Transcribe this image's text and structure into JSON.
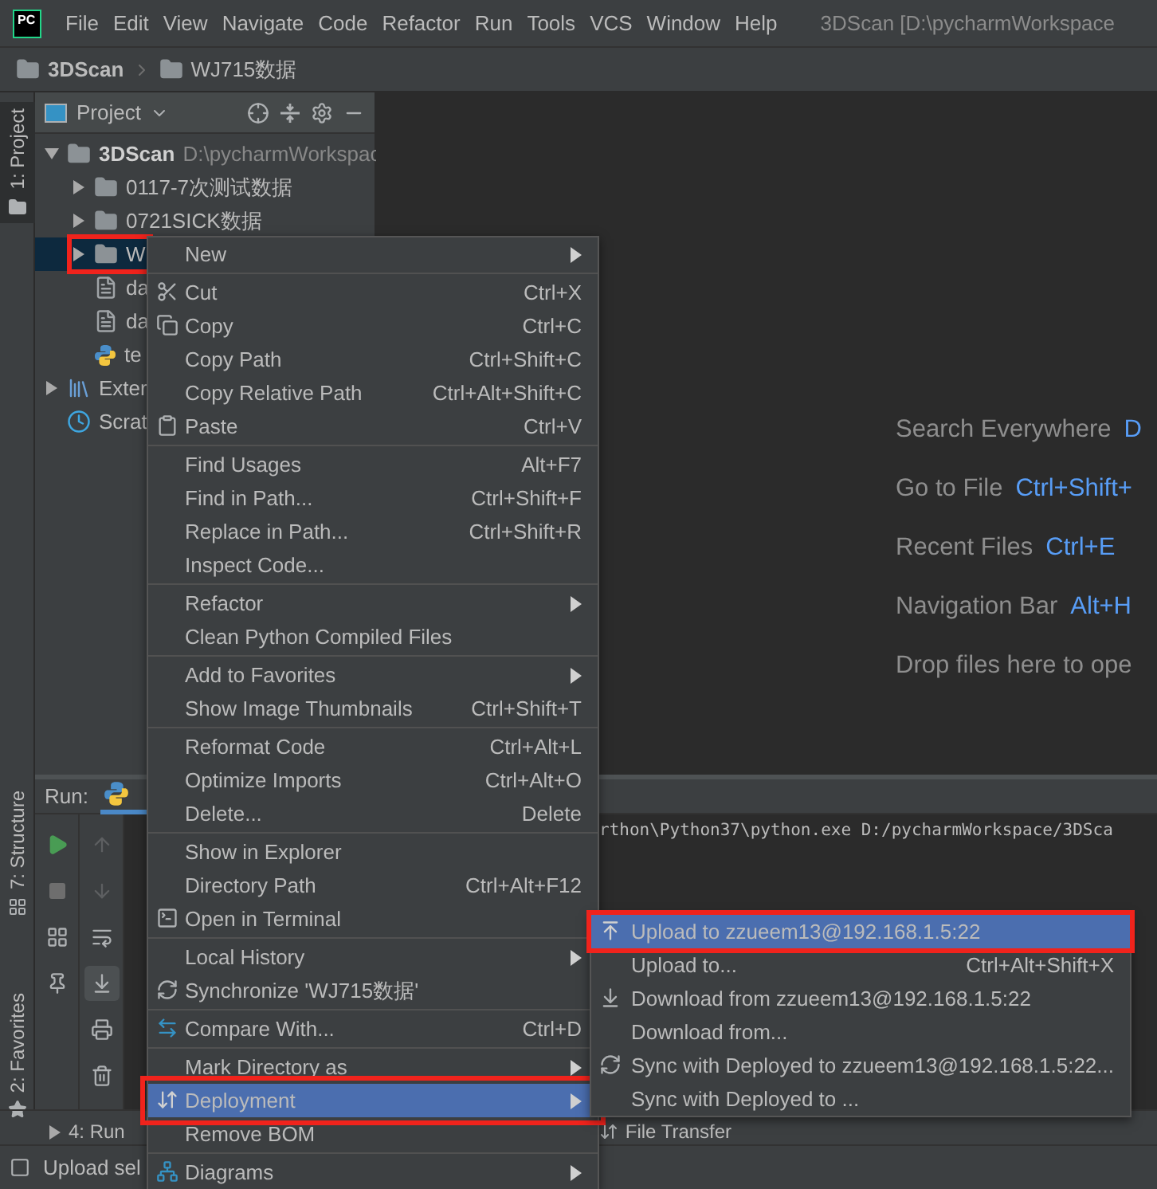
{
  "logo": "PC",
  "menubar": [
    "File",
    "Edit",
    "View",
    "Navigate",
    "Code",
    "Refactor",
    "Run",
    "Tools",
    "VCS",
    "Window",
    "Help"
  ],
  "window_title": "3DScan [D:\\pycharmWorkspace",
  "breadcrumb": [
    "3DScan",
    "WJ715数据"
  ],
  "tool_strip": [
    {
      "label": "1: Project",
      "selected": true
    },
    {
      "label": "7: Structure",
      "selected": false
    },
    {
      "label": "2: Favorites",
      "selected": false
    }
  ],
  "project_panel": {
    "title": "Project",
    "tree": [
      {
        "label": "3DScan",
        "path": "D:\\pycharmWorkspac",
        "kind": "folder",
        "expanded": true,
        "selected": false,
        "children": [
          {
            "label": "0117-7次测试数据",
            "kind": "folder",
            "expanded": false,
            "selected": false
          },
          {
            "label": "0721SICK数据",
            "kind": "folder",
            "expanded": false,
            "selected": false
          },
          {
            "label": "W",
            "kind": "folder",
            "expanded": false,
            "selected": true
          },
          {
            "label": "da",
            "kind": "file",
            "selected": false
          },
          {
            "label": "da",
            "kind": "file",
            "selected": false
          },
          {
            "label": "te",
            "kind": "python",
            "selected": false
          }
        ]
      },
      {
        "label": "Exter",
        "kind": "library",
        "expanded": false,
        "selected": false
      },
      {
        "label": "Scrat",
        "kind": "scratch",
        "selected": false
      }
    ]
  },
  "editor_hints": [
    {
      "label": "Search Everywhere",
      "shortcut": "D"
    },
    {
      "label": "Go to File",
      "shortcut": "Ctrl+Shift+"
    },
    {
      "label": "Recent Files",
      "shortcut": "Ctrl+E"
    },
    {
      "label": "Navigation Bar",
      "shortcut": "Alt+H"
    },
    {
      "label": "Drop files here to ope"
    }
  ],
  "run_panel": {
    "title": "Run:",
    "console_line": "rthon\\Python37\\python.exe D:/pycharmWorkspace/3DSca"
  },
  "bottom_tabs": [
    {
      "label": "4: Run"
    },
    {
      "label": "File Transfer"
    }
  ],
  "status_bar": "Upload sel",
  "context_menu": [
    {
      "kind": "item",
      "label": "New",
      "submenu": true,
      "selected": false
    },
    {
      "kind": "separator"
    },
    {
      "kind": "item",
      "label": "Cut",
      "shortcut": "Ctrl+X",
      "selected": false
    },
    {
      "kind": "item",
      "label": "Copy",
      "shortcut": "Ctrl+C",
      "selected": false
    },
    {
      "kind": "item",
      "label": "Copy Path",
      "shortcut": "Ctrl+Shift+C",
      "selected": false
    },
    {
      "kind": "item",
      "label": "Copy Relative Path",
      "shortcut": "Ctrl+Alt+Shift+C",
      "selected": false
    },
    {
      "kind": "item",
      "label": "Paste",
      "shortcut": "Ctrl+V",
      "selected": false
    },
    {
      "kind": "separator"
    },
    {
      "kind": "item",
      "label": "Find Usages",
      "shortcut": "Alt+F7",
      "selected": false
    },
    {
      "kind": "item",
      "label": "Find in Path...",
      "shortcut": "Ctrl+Shift+F",
      "selected": false
    },
    {
      "kind": "item",
      "label": "Replace in Path...",
      "shortcut": "Ctrl+Shift+R",
      "selected": false
    },
    {
      "kind": "item",
      "label": "Inspect Code...",
      "selected": false
    },
    {
      "kind": "separator"
    },
    {
      "kind": "item",
      "label": "Refactor",
      "submenu": true,
      "selected": false
    },
    {
      "kind": "item",
      "label": "Clean Python Compiled Files",
      "selected": false
    },
    {
      "kind": "separator"
    },
    {
      "kind": "item",
      "label": "Add to Favorites",
      "submenu": true,
      "selected": false
    },
    {
      "kind": "item",
      "label": "Show Image Thumbnails",
      "shortcut": "Ctrl+Shift+T",
      "selected": false
    },
    {
      "kind": "separator"
    },
    {
      "kind": "item",
      "label": "Reformat Code",
      "shortcut": "Ctrl+Alt+L",
      "selected": false
    },
    {
      "kind": "item",
      "label": "Optimize Imports",
      "shortcut": "Ctrl+Alt+O",
      "selected": false
    },
    {
      "kind": "item",
      "label": "Delete...",
      "shortcut": "Delete",
      "selected": false
    },
    {
      "kind": "separator"
    },
    {
      "kind": "item",
      "label": "Show in Explorer",
      "selected": false
    },
    {
      "kind": "item",
      "label": "Directory Path",
      "shortcut": "Ctrl+Alt+F12",
      "selected": false
    },
    {
      "kind": "item",
      "label": "Open in Terminal",
      "selected": false
    },
    {
      "kind": "separator"
    },
    {
      "kind": "item",
      "label": "Local History",
      "submenu": true,
      "selected": false
    },
    {
      "kind": "item",
      "label": "Synchronize 'WJ715数据'",
      "selected": false
    },
    {
      "kind": "separator"
    },
    {
      "kind": "item",
      "label": "Compare With...",
      "shortcut": "Ctrl+D",
      "selected": false
    },
    {
      "kind": "separator"
    },
    {
      "kind": "item",
      "label": "Mark Directory as",
      "submenu": true,
      "selected": false
    },
    {
      "kind": "item",
      "label": "Deployment",
      "submenu": true,
      "selected": true
    },
    {
      "kind": "item",
      "label": "Remove BOM",
      "selected": false
    },
    {
      "kind": "separator"
    },
    {
      "kind": "item",
      "label": "Diagrams",
      "submenu": true,
      "selected": false
    }
  ],
  "deployment_submenu": [
    {
      "label": "Upload to zzueem13@192.168.1.5:22",
      "selected": true
    },
    {
      "label": "Upload to...",
      "shortcut": "Ctrl+Alt+Shift+X",
      "selected": false
    },
    {
      "label": "Download from zzueem13@192.168.1.5:22",
      "selected": false
    },
    {
      "label": "Download from...",
      "selected": false
    },
    {
      "label": "Sync with Deployed to zzueem13@192.168.1.5:22...",
      "selected": false
    },
    {
      "label": "Sync with Deployed to ...",
      "selected": false
    }
  ]
}
